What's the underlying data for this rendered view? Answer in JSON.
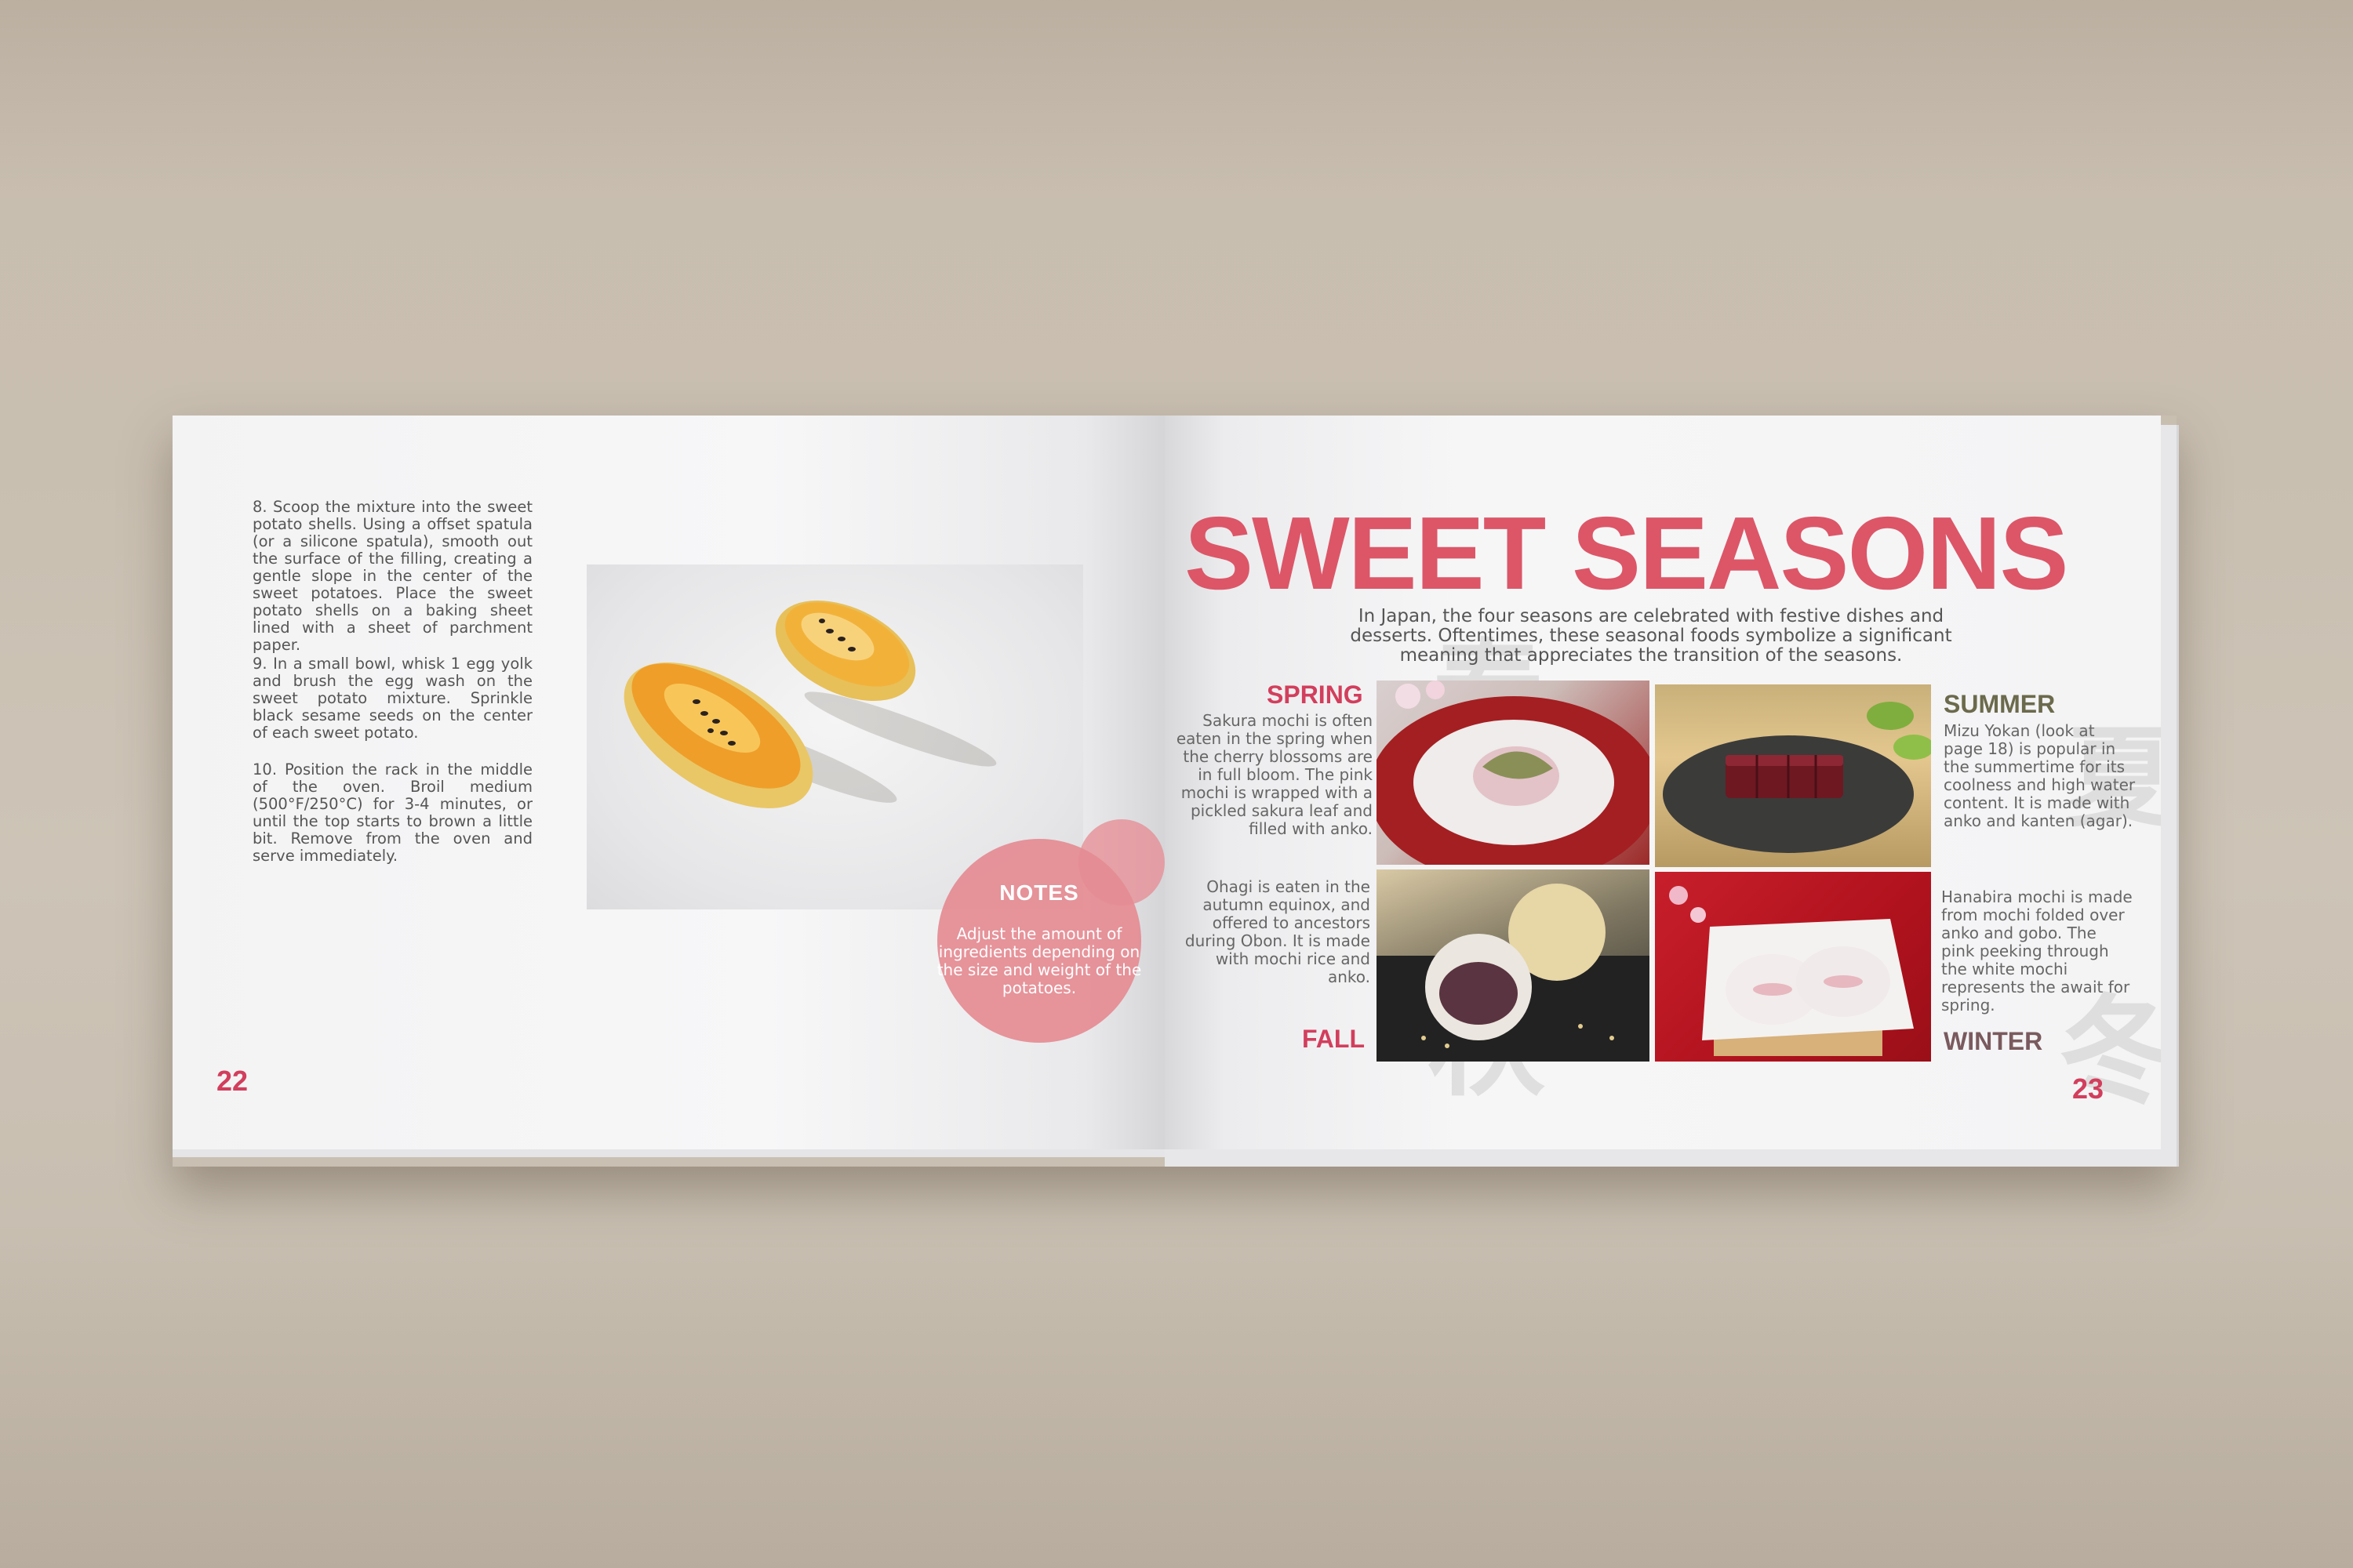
{
  "left_page": {
    "steps": [
      "8. Scoop the mixture into the sweet potato shells. Using a offset spatula (or a silicone spatula), smooth out the surface of the filling, creating a gentle slope in the center of the sweet potatoes. Place the sweet potato shells on a baking sheet lined with a sheet of parchment paper.",
      "9. In a small bowl, whisk 1 egg yolk and brush the egg wash on the sweet potato mixture. Sprinkle black sesame seeds on the center of each sweet potato.",
      "10. Position the rack in the middle of the oven. Broil medium (500°F/250°C) for 3-4 minutes, or until the top starts to brown a little bit. Remove from the oven and serve immediately."
    ],
    "notes": {
      "title": "NOTES",
      "body": "Adjust the amount of ingredients depending on the size and weight of the potatoes."
    },
    "page_number": "22"
  },
  "right_page": {
    "title": "SWEET SEASONS",
    "intro": "In Japan, the four seasons are celebrated with festive dishes and desserts. Oftentimes, these seasonal foods symbolize a significant meaning that appreciates the transition of the seasons.",
    "seasons": {
      "spring": {
        "label": "SPRING",
        "text": "Sakura mochi is often eaten in the spring when the cherry blossoms are in full bloom. The pink mochi is wrapped with a pickled sakura leaf and filled with anko."
      },
      "summer": {
        "label": "SUMMER",
        "text": "Mizu Yokan (look at page 18) is popular in the summertime for its coolness and high water content. It is made with anko and kanten (agar)."
      },
      "fall": {
        "label": "FALL",
        "text": "Ohagi is eaten in the autumn equinox, and offered to ancestors during Obon. It is made with mochi rice and anko."
      },
      "winter": {
        "label": "WINTER",
        "text": "Hanabira mochi is made from mochi folded over anko and gobo. The pink peeking through the white mochi represents the await for spring."
      }
    },
    "page_number": "23"
  },
  "colors": {
    "accent": "#d23e5c",
    "title_pink": "#dc5668",
    "notes_pink": "#e58b92",
    "summer_olive": "#6b6a4c",
    "winter_plum": "#7a5a5e"
  }
}
